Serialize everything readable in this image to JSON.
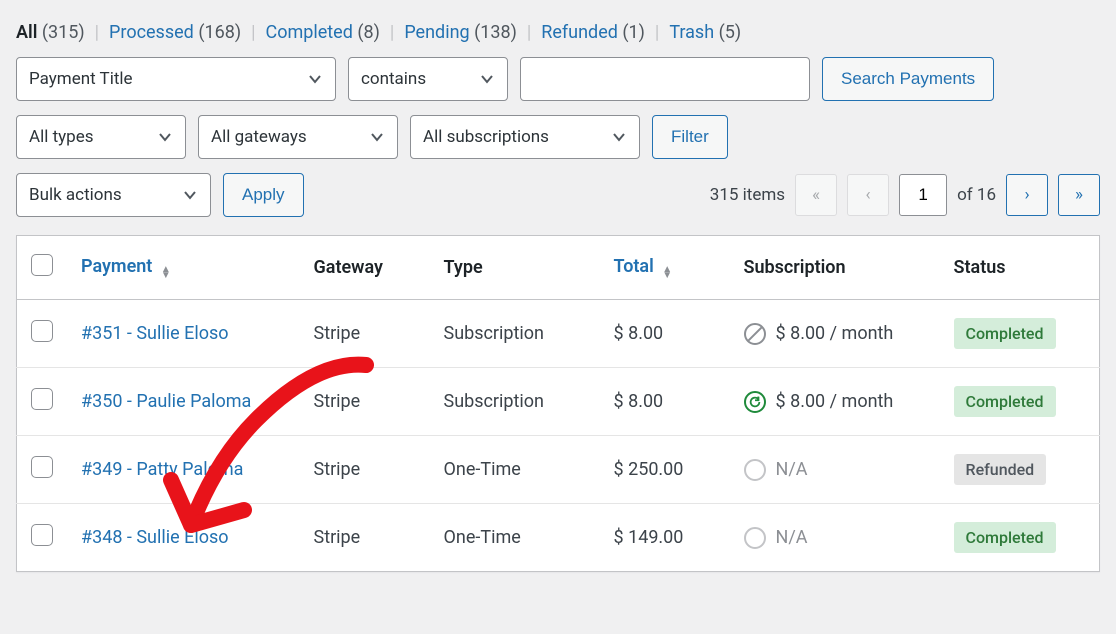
{
  "filters": {
    "all": {
      "label": "All",
      "count": "(315)"
    },
    "processed": {
      "label": "Processed",
      "count": "(168)"
    },
    "completed": {
      "label": "Completed",
      "count": "(8)"
    },
    "pending": {
      "label": "Pending",
      "count": "(138)"
    },
    "refunded": {
      "label": "Refunded",
      "count": "(1)"
    },
    "trash": {
      "label": "Trash",
      "count": "(5)"
    }
  },
  "search": {
    "field_select": "Payment Title",
    "op_select": "contains",
    "input_value": "",
    "button": "Search Payments"
  },
  "filterbar": {
    "types": "All types",
    "gateways": "All gateways",
    "subs": "All subscriptions",
    "filter_btn": "Filter"
  },
  "bulk": {
    "select": "Bulk actions",
    "apply": "Apply"
  },
  "pager": {
    "items": "315 items",
    "page": "1",
    "of": "of 16"
  },
  "columns": {
    "payment": "Payment",
    "gateway": "Gateway",
    "type": "Type",
    "total": "Total",
    "subscription": "Subscription",
    "status": "Status"
  },
  "rows": [
    {
      "payment": "#351 - Sullie Eloso",
      "gateway": "Stripe",
      "type": "Subscription",
      "total": "$ 8.00",
      "sub_icon": "cancel",
      "sub_text": "$ 8.00 / month",
      "status": "Completed",
      "status_class": "status-completed"
    },
    {
      "payment": "#350 - Paulie Paloma",
      "gateway": "Stripe",
      "type": "Subscription",
      "total": "$ 8.00",
      "sub_icon": "refresh",
      "sub_text": "$ 8.00 / month",
      "status": "Completed",
      "status_class": "status-completed"
    },
    {
      "payment": "#349 - Patty Paloma",
      "gateway": "Stripe",
      "type": "One-Time",
      "total": "$ 250.00",
      "sub_icon": "empty",
      "sub_text": "N/A",
      "status": "Refunded",
      "status_class": "status-refunded"
    },
    {
      "payment": "#348 - Sullie Eloso",
      "gateway": "Stripe",
      "type": "One-Time",
      "total": "$ 149.00",
      "sub_icon": "empty",
      "sub_text": "N/A",
      "status": "Completed",
      "status_class": "status-completed"
    }
  ]
}
